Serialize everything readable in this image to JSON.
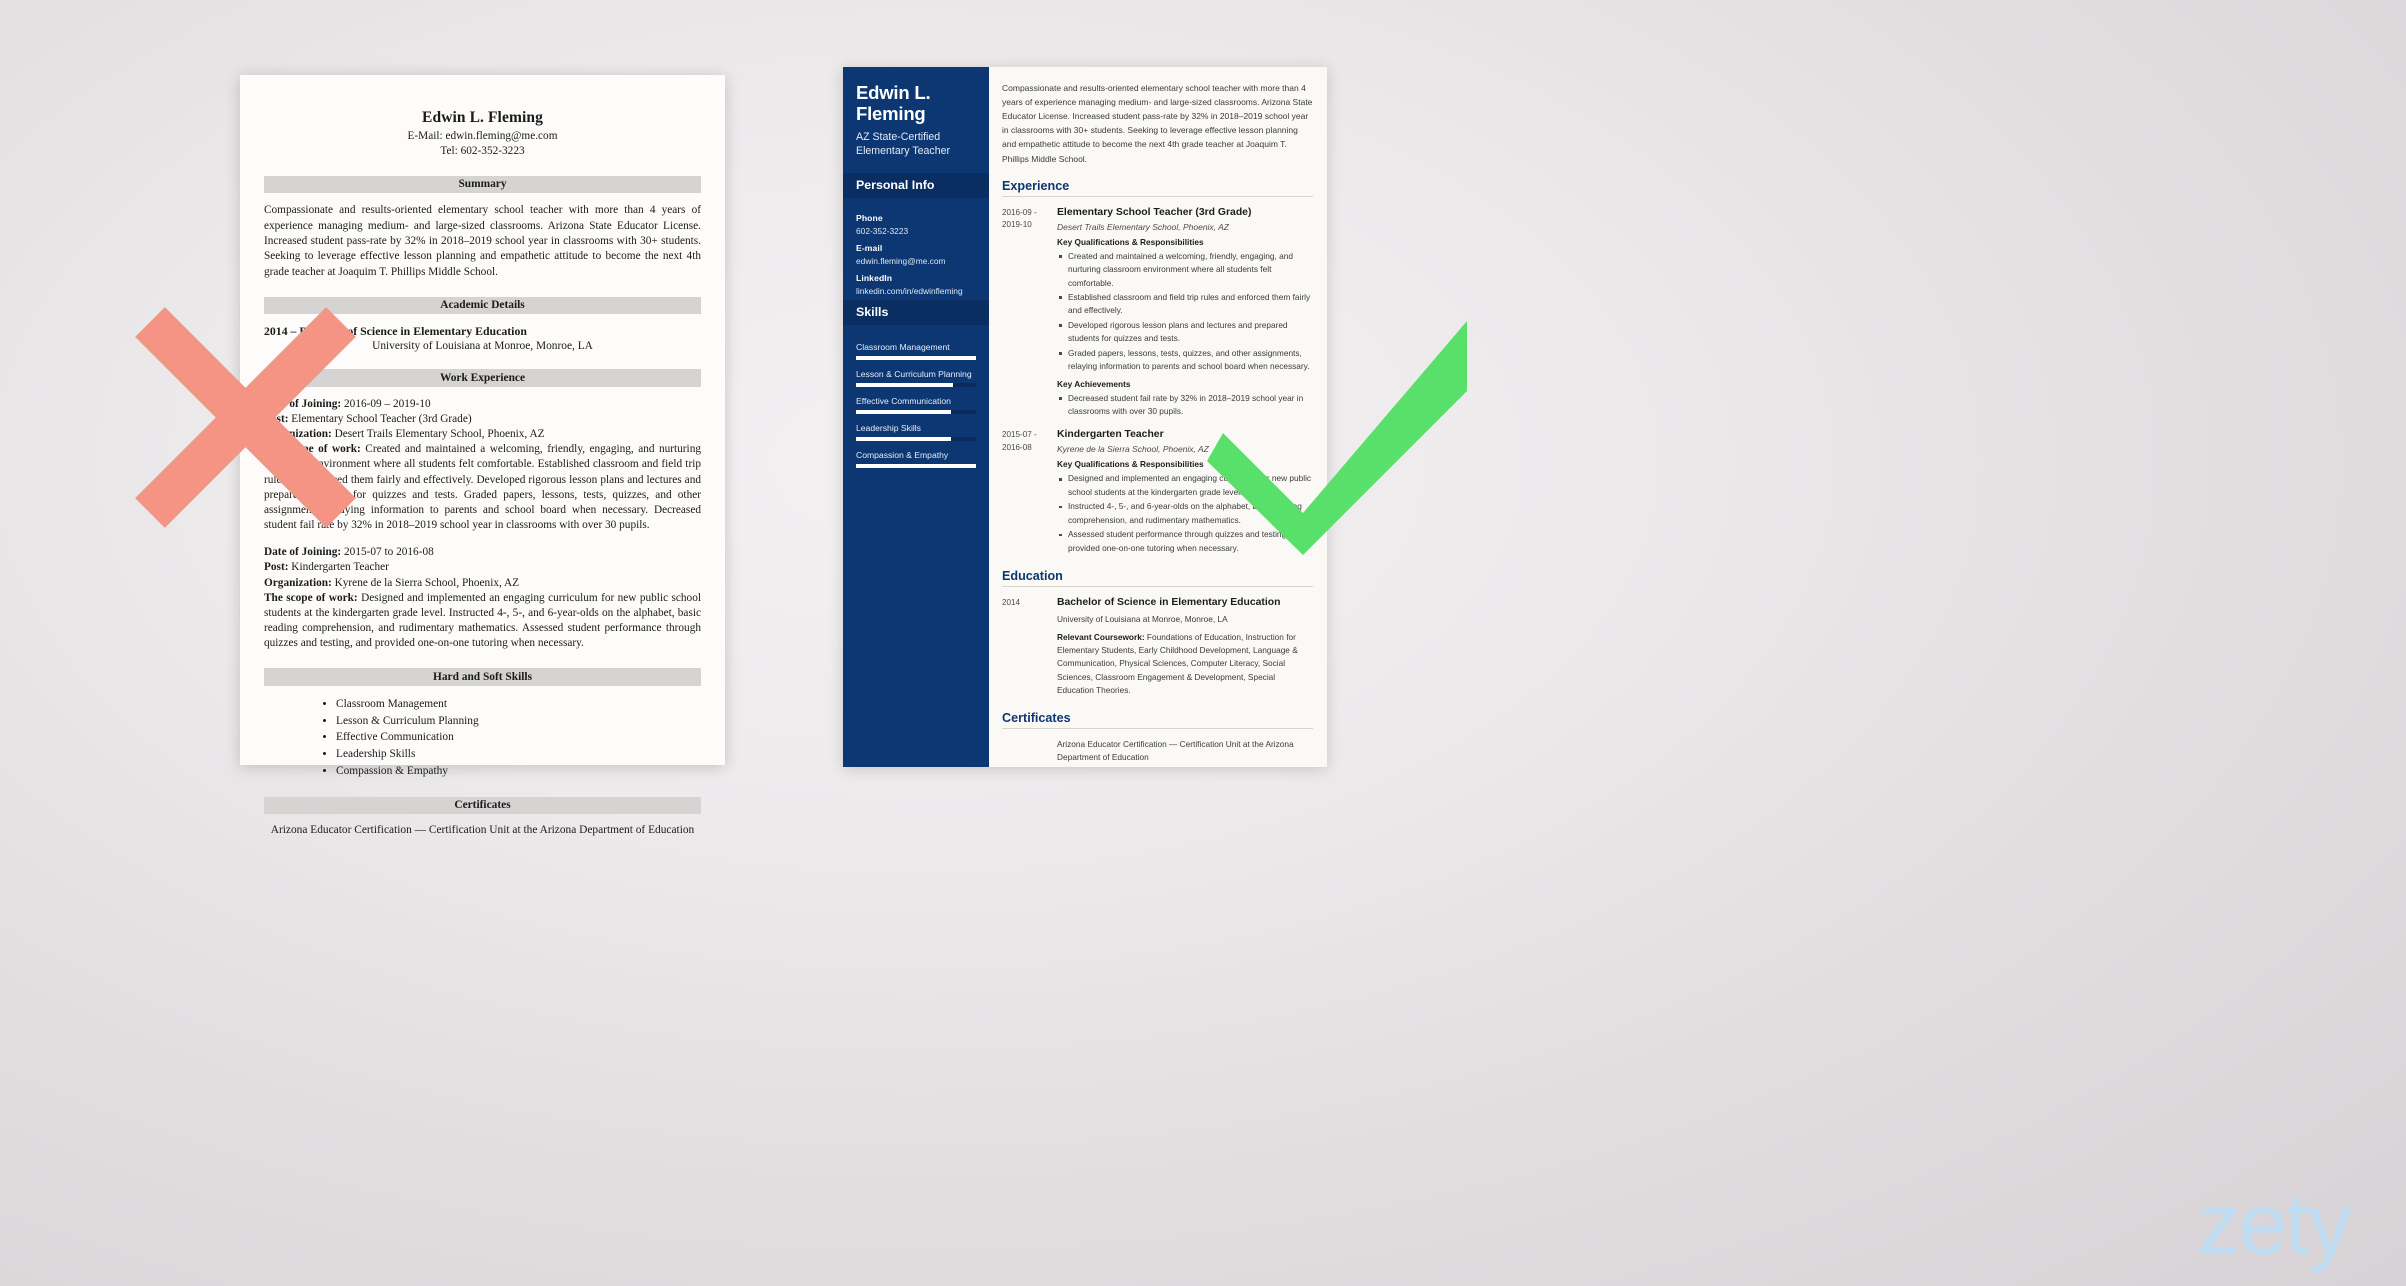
{
  "bad_resume": {
    "name": "Edwin L. Fleming",
    "email_line": "E-Mail: edwin.fleming@me.com",
    "phone_line": "Tel: 602-352-3223",
    "sections": {
      "summary_heading": "Summary",
      "summary_text": "Compassionate and results-oriented elementary school teacher with more than 4 years of experience managing medium- and large-sized classrooms. Arizona State Educator License. Increased student pass-rate by 32% in 2018–2019 school year in classrooms with 30+ students. Seeking to leverage effective lesson planning and empathetic attitude to become the next 4th grade teacher at Joaquim T. Phillips Middle School.",
      "academic_heading": "Academic Details",
      "academic_degree": "2014 – Bachelor of Science in Elementary Education",
      "academic_school": "University of Louisiana at Monroe, Monroe, LA",
      "work_heading": "Work Experience",
      "skills_heading": "Hard and Soft Skills",
      "certificates_heading": "Certificates",
      "certificate_text": "Arizona Educator Certification — Certification Unit at the Arizona Department of Education"
    },
    "jobs": [
      {
        "date_label": "Date of Joining:",
        "date_value": "2016-09 – 2019-10",
        "post_label": "Post:",
        "post_value": "Elementary School Teacher (3rd Grade)",
        "org_label": "Organization:",
        "org_value": "Desert Trails Elementary School, Phoenix, AZ",
        "scope_label": "The scope of work:",
        "scope_value": "Created and maintained a welcoming, friendly, engaging, and nurturing classroom environment where all students felt comfortable. Established classroom and field trip rules and enforced them fairly and effectively. Developed rigorous lesson plans and lectures and prepared students for quizzes and tests. Graded papers, lessons, tests, quizzes, and other assignments, relaying information to parents and school board when necessary. Decreased student fail rate by 32% in 2018–2019 school year in classrooms with over 30 pupils."
      },
      {
        "date_label": "Date of Joining:",
        "date_value": "2015-07 to 2016-08",
        "post_label": "Post:",
        "post_value": "Kindergarten Teacher",
        "org_label": "Organization:",
        "org_value": "Kyrene de la Sierra School, Phoenix, AZ",
        "scope_label": "The scope of work:",
        "scope_value": "Designed and implemented an engaging curriculum for new public school students at the kindergarten grade level. Instructed 4-, 5-, and 6-year-olds on the alphabet, basic reading comprehension, and rudimentary mathematics. Assessed student performance through quizzes and testing, and provided one-on-one tutoring when necessary."
      }
    ],
    "skills": [
      "Classroom Management",
      "Lesson & Curriculum Planning",
      "Effective Communication",
      "Leadership Skills",
      "Compassion & Empathy"
    ]
  },
  "good_resume": {
    "sidebar": {
      "name": "Edwin L. Fleming",
      "job_title": "AZ State-Certified Elementary Teacher",
      "personal_info_heading": "Personal Info",
      "contacts": [
        {
          "label": "Phone",
          "value": "602-352-3223"
        },
        {
          "label": "E-mail",
          "value": "edwin.fleming@me.com"
        },
        {
          "label": "LinkedIn",
          "value": "linkedin.com/in/edwinfleming"
        }
      ],
      "skills_heading": "Skills",
      "skills": [
        {
          "name": "Classroom Management",
          "level": 100
        },
        {
          "name": "Lesson & Curriculum Planning",
          "level": 81
        },
        {
          "name": "Effective Communication",
          "level": 79
        },
        {
          "name": "Leadership Skills",
          "level": 79
        },
        {
          "name": "Compassion & Empathy",
          "level": 100
        }
      ]
    },
    "summary": "Compassionate and results-oriented elementary school teacher with more than 4 years of experience managing medium- and large-sized classrooms. Arizona State Educator License. Increased student pass-rate by 32% in 2018–2019 school year in classrooms with 30+ students. Seeking to leverage effective lesson planning and empathetic attitude to become the next 4th grade teacher at Joaquim T. Phillips Middle School.",
    "experience_heading": "Experience",
    "experience": [
      {
        "date": "2016-09 - 2019-10",
        "title": "Elementary School Teacher (3rd Grade)",
        "org": "Desert Trails Elementary School, Phoenix, AZ",
        "qualifications_heading": "Key Qualifications & Responsibilities",
        "bullets": [
          "Created and maintained a welcoming, friendly, engaging, and nurturing classroom environment where all students felt comfortable.",
          "Established classroom and field trip rules and enforced them fairly and effectively.",
          "Developed rigorous lesson plans and lectures and prepared students for quizzes and tests.",
          "Graded papers, lessons, tests, quizzes, and other assignments, relaying information to parents and school board when necessary."
        ],
        "achievements_heading": "Key Achievements",
        "achievements": [
          "Decreased student fail rate by 32% in 2018–2019 school year in classrooms with over 30 pupils."
        ]
      },
      {
        "date": "2015-07 - 2016-08",
        "title": "Kindergarten Teacher",
        "org": "Kyrene de la Sierra School, Phoenix, AZ",
        "qualifications_heading": "Key Qualifications & Responsibilities",
        "bullets": [
          "Designed and implemented an engaging curriculum for new public school students at the kindergarten grade level.",
          "Instructed 4-, 5-, and 6-year-olds on the alphabet, basic reading comprehension, and rudimentary mathematics.",
          "Assessed student performance through quizzes and testing, and provided one-on-one tutoring when necessary."
        ]
      }
    ],
    "education_heading": "Education",
    "education": {
      "date": "2014",
      "degree": "Bachelor of Science in Elementary Education",
      "school": "University of Louisiana at Monroe, Monroe, LA",
      "coursework_label": "Relevant Coursework:",
      "coursework_text": " Foundations of Education, Instruction for Elementary Students, Early Childhood Development, Language & Communication, Physical Sciences, Computer Literacy, Social Sciences, Classroom Engagement & Development, Special Education Theories."
    },
    "certificates_heading": "Certificates",
    "certificate_text": "Arizona Educator Certification — Certification Unit at the Arizona Department of Education"
  },
  "annotations": {
    "reject_mark": "red-x-mark",
    "approve_mark": "green-check-mark",
    "reject_color": "#f59385",
    "approve_color": "#59e06a"
  },
  "watermark": {
    "text": "zety",
    "color": "#bfdcf2"
  }
}
